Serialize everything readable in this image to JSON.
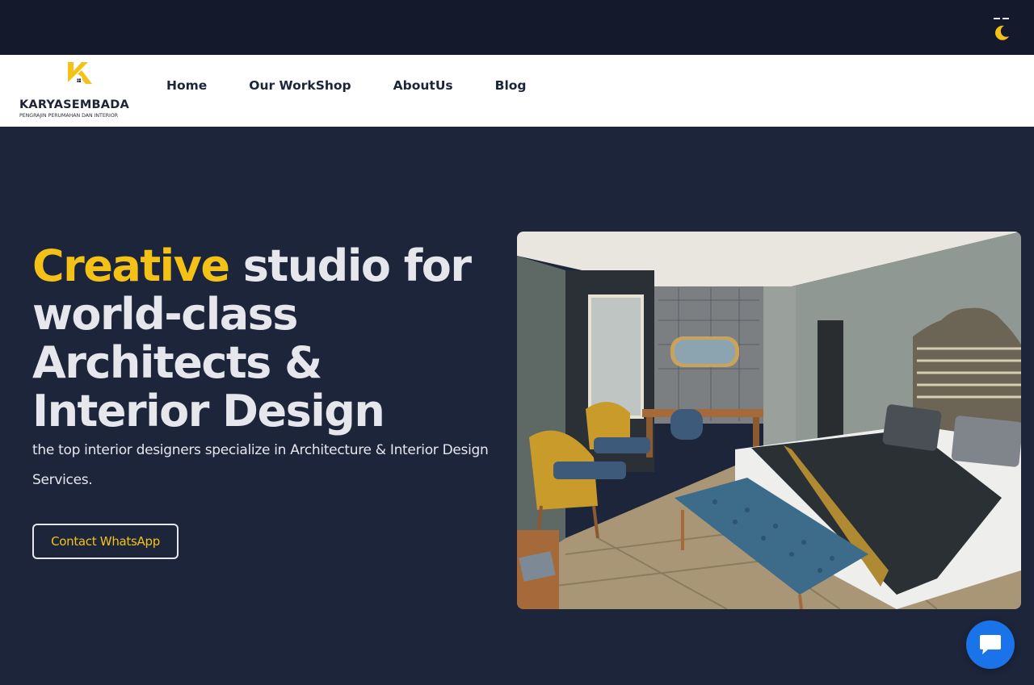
{
  "theme_toggle": {
    "icon": "moon-icon",
    "color": "#f4c216"
  },
  "brand": {
    "name": "KARYASEMBADA",
    "tagline": "PENGRAJIN PERUMAHAN DAN INTERIOR",
    "accent_color": "#f4c216"
  },
  "nav": {
    "items": [
      {
        "label": "Home"
      },
      {
        "label": "Our WorkShop"
      },
      {
        "label": "AboutUs"
      },
      {
        "label": "Blog"
      }
    ]
  },
  "hero": {
    "title_accent": "Creative",
    "title_rest": " studio for world-class Architects & Interior Design",
    "subtitle": "the top interior designers specialize in Architecture & Interior Design Services.",
    "cta_label": "Contact WhatsApp",
    "image": "hotel-bedroom-photo"
  },
  "chat": {
    "icon": "chat-bubble-icon",
    "color": "#1a73e8"
  },
  "colors": {
    "background": "#1d253b",
    "topbar": "#141a2b",
    "accent": "#f4c216",
    "text": "#e6e7ec"
  }
}
